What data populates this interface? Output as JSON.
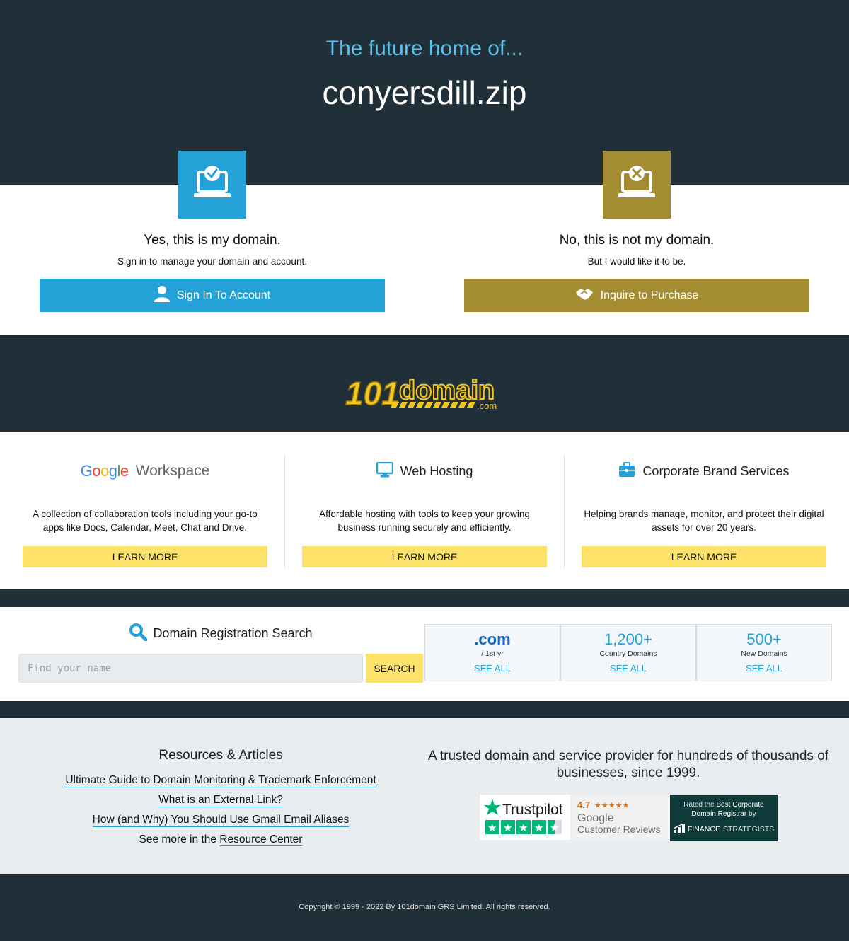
{
  "hero": {
    "subtitle": "The future home of...",
    "domain": "conyersdill.zip"
  },
  "choices": {
    "yes": {
      "icon": "laptop-check-icon",
      "heading": "Yes, this is my domain.",
      "text": "Sign in to manage your domain and account.",
      "button_label": "Sign In To Account",
      "button_icon": "user-icon",
      "color": "#24a2d8"
    },
    "no": {
      "icon": "laptop-x-icon",
      "heading": "No, this is not my domain.",
      "text": "But I would like it to be.",
      "button_label": "Inquire to Purchase",
      "button_icon": "handshake-icon",
      "color": "#a48c32"
    }
  },
  "logo": {
    "number": "101",
    "word": "domain",
    "suffix": ".com"
  },
  "services": [
    {
      "title_google": "Google",
      "title_rest": "Workspace",
      "icon": "google-workspace-logo",
      "description": "A collection of collaboration tools including your go-to apps like Docs, Calendar, Meet, Chat and Drive.",
      "button_label": "LEARN MORE"
    },
    {
      "title": "Web Hosting",
      "icon": "monitor-icon",
      "description": "Affordable hosting with tools to keep your growing business running securely and efficiently.",
      "button_label": "LEARN MORE"
    },
    {
      "title": "Corporate Brand Services",
      "icon": "briefcase-icon",
      "description": "Helping brands manage, monitor, and protect their digital assets for over 20 years.",
      "button_label": "LEARN MORE"
    }
  ],
  "search": {
    "title": "Domain Registration Search",
    "icon": "search-icon",
    "placeholder": "Find your name",
    "button_label": "SEARCH"
  },
  "stats": [
    {
      "big": ".com",
      "small": "/ 1st yr",
      "link": "SEE ALL"
    },
    {
      "big": "1,200+",
      "small": "Country Domains",
      "link": "SEE ALL"
    },
    {
      "big": "500+",
      "small": "New Domains",
      "link": "SEE ALL"
    }
  ],
  "resources": {
    "heading": "Resources & Articles",
    "links": [
      "Ultimate Guide to Domain Monitoring & Trademark Enforcement",
      "What is an External Link?",
      "How (and Why) You Should Use Gmail Email Aliases"
    ],
    "more_prefix": "See more in the",
    "more_link": "Resource Center"
  },
  "trust": {
    "heading": "A trusted domain and service provider for hundreds of thousands of businesses, since 1999.",
    "trustpilot": "Trustpilot",
    "google_rating": "4.7",
    "google_name": "Google",
    "google_sub": "Customer Reviews",
    "fs_line1_a": "Rated the",
    "fs_line1_b": "Best Corporate",
    "fs_line2_a": "Domain Registrar",
    "fs_line2_b": "by",
    "fs_brand_a": "FINANCE",
    "fs_brand_b": "STRATEGISTS"
  },
  "footer": {
    "copyright": "Copyright © 1999 - 2022 By 101domain GRS Limited. All rights reserved."
  },
  "colors": {
    "dark": "#212f38",
    "blue": "#24a2d8",
    "gold": "#a48c32",
    "yellow": "#fde26a",
    "light_bg": "#e9edf0"
  }
}
